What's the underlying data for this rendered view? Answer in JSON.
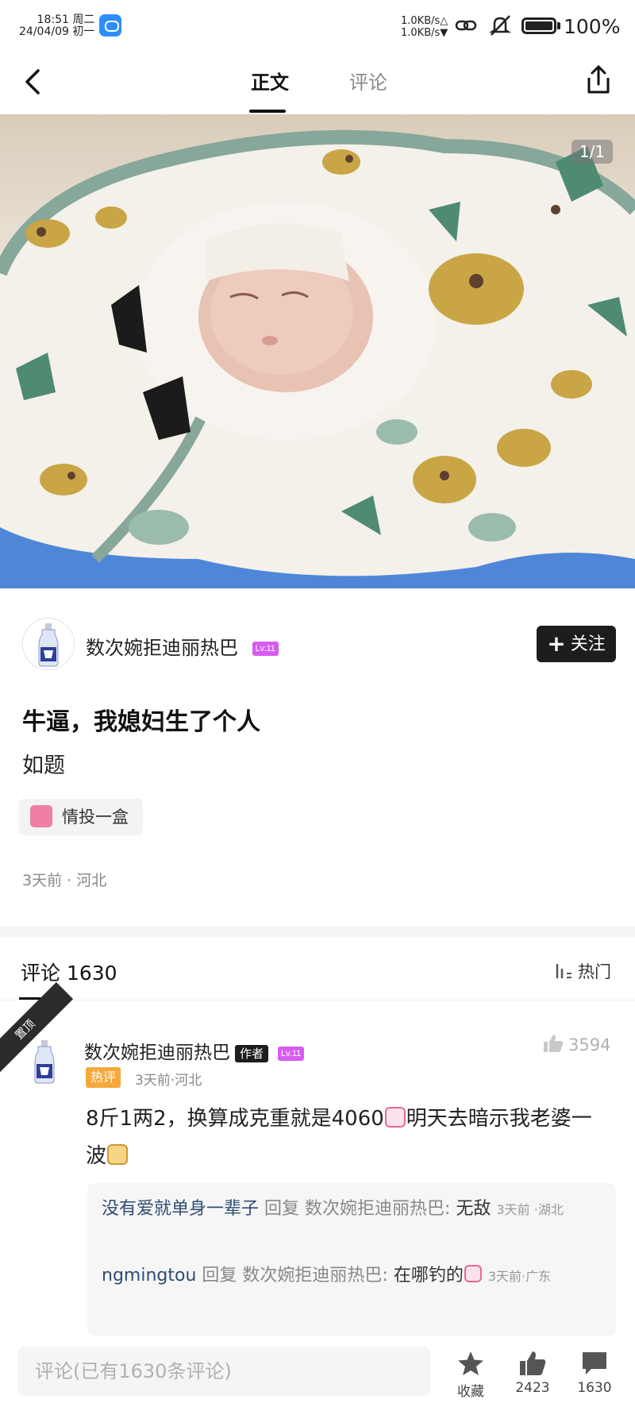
{
  "status_bar": {
    "time": "18:51 周二",
    "date": "24/04/09 初一",
    "net_up": "1.0KB/s△",
    "net_down": "1.0KB/s▼",
    "battery": "100%",
    "icons": [
      "app-icon",
      "link-icon",
      "mute-icon",
      "battery-icon"
    ]
  },
  "nav": {
    "tabs": [
      "正文",
      "评论"
    ],
    "active_tab": "正文"
  },
  "photo": {
    "counter": "1/1"
  },
  "author": {
    "name": "数次婉拒迪丽热巴",
    "level": "Lv.11",
    "follow_label": "关注"
  },
  "post": {
    "title": "牛逼，我媳妇生了个人",
    "body": "如题",
    "topic": "情投一盒",
    "time_location": "3天前 · 河北"
  },
  "comments": {
    "header": "评论 1630",
    "sort": "热门",
    "pinned_label": "置顶",
    "top": {
      "name": "数次婉拒迪丽热巴",
      "author_tag": "作者",
      "level": "Lv.11",
      "likes": "3594",
      "hot_tag": "热评",
      "meta": "3天前·河北",
      "text_part1": "8斤1两2，换算成克重就是4060",
      "text_part2": "明天去暗示我老婆一波",
      "replies": [
        {
          "name": "没有爱就单身一辈子",
          "word": "回复",
          "target": "数次婉拒迪丽热巴:",
          "text": "无敌",
          "meta": "3天前 ·湖北"
        },
        {
          "name": "ngmingtou",
          "word": "回复",
          "target": "数次婉拒迪丽热巴:",
          "text": "在哪钓的",
          "meta": "3天前·广东"
        }
      ]
    }
  },
  "bottom_bar": {
    "placeholder": "评论(已有1630条评论)",
    "collect_label": "收藏",
    "like_count": "2423",
    "comment_count": "1630"
  },
  "colors": {
    "accent_dark": "#1d1d1f",
    "level_badge": "#d75cf0",
    "hot_tag": "#f6a83b",
    "reply_name": "#2f4c73"
  }
}
